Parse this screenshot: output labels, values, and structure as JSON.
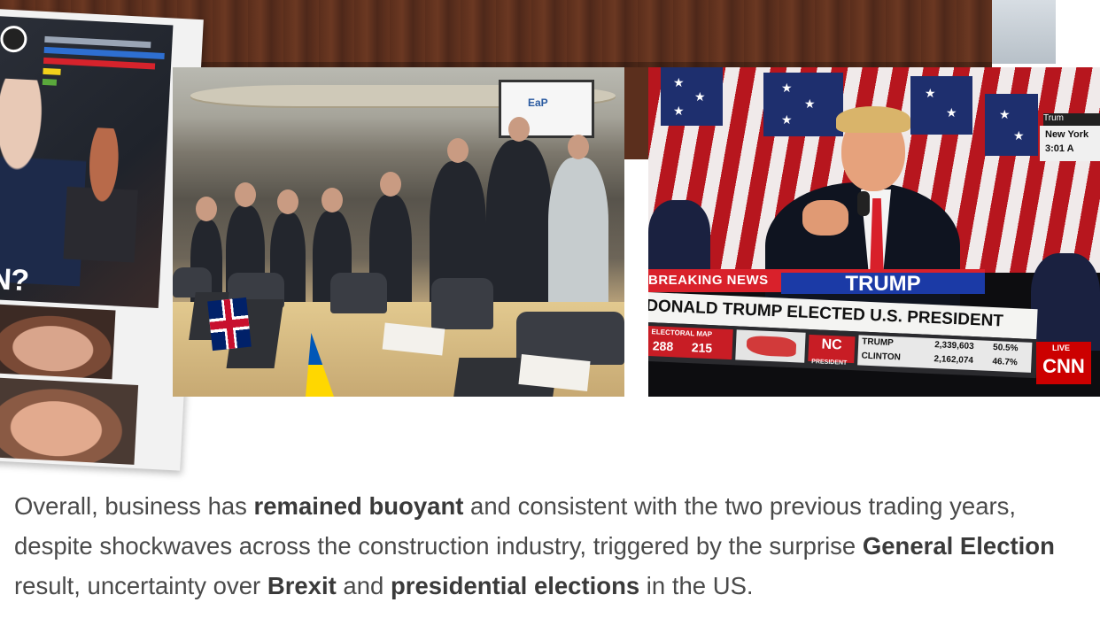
{
  "newspaper": {
    "headline_fragment": "IN?"
  },
  "photo_summit": {
    "screen_text": "EaP"
  },
  "photo_broadcast": {
    "breaking_label": "BREAKING NEWS",
    "banner": "TRUMP",
    "chyron": "DONALD TRUMP ELECTED U.S. PRESIDENT",
    "state": "NC",
    "state_sub": "PRESIDENT",
    "electoral_label": "ELECTORAL MAP",
    "electoral_a": "288",
    "electoral_b": "215",
    "candidate_1": "TRUMP",
    "votes_1": "2,339,603",
    "pct_1": "50.5%",
    "candidate_2": "CLINTON",
    "votes_2": "2,162,074",
    "pct_2": "46.7%",
    "network": "CNN",
    "live": "LIVE",
    "corner_1": "Trum",
    "corner_2": "New York",
    "corner_3": "3:01 A"
  },
  "article": {
    "p1": "Overall, business has ",
    "b1": "remained buoyant",
    "p2": " and consistent with the two previous trading years, despite shockwaves across the construction industry, triggered by the surprise ",
    "b2": "General Election",
    "p3": " result, uncertainty over ",
    "b3": "Brexit",
    "p4": " and ",
    "b4": "presidential elections",
    "p5": " in the US."
  }
}
